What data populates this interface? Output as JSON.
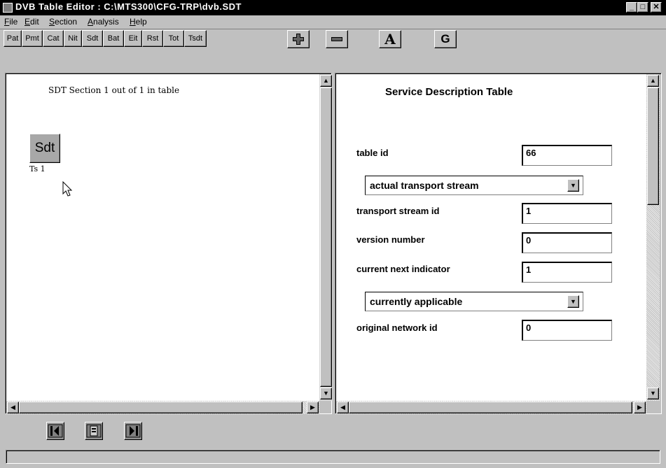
{
  "window": {
    "title": "DVB Table Editor : C:\\MTS300\\CFG-TRP\\dvb.SDT",
    "controls": {
      "minimize": "_",
      "maximize": "□",
      "close": "✕"
    }
  },
  "menu": [
    {
      "label": "File",
      "mnemonic": "F",
      "rest": "ile"
    },
    {
      "label": "Edit",
      "mnemonic": "E",
      "rest": "dit"
    },
    {
      "label": "Section",
      "mnemonic": "S",
      "rest": "ection"
    },
    {
      "label": "Analysis",
      "mnemonic": "A",
      "rest": "nalysis"
    },
    {
      "label": "Help",
      "mnemonic": "H",
      "rest": "elp"
    }
  ],
  "toolbar": {
    "tables": [
      "Pat",
      "Pmt",
      "Cat",
      "Nit",
      "Sdt",
      "Bat",
      "Eit",
      "Rst",
      "Tot",
      "Tsdt"
    ],
    "add": "+",
    "remove": "−",
    "a_button": "A",
    "g_button": "G"
  },
  "left_pane": {
    "header": "SDT Section 1 out of 1 in table",
    "node_label": "Sdt",
    "node_caption": "Ts 1"
  },
  "right_pane": {
    "heading": "Service Description Table",
    "table_id_label": "table id",
    "table_id_value": "66",
    "stream_type_selected": "actual transport stream",
    "transport_stream_id_label": "transport stream id",
    "transport_stream_id_value": "1",
    "version_number_label": "version number",
    "version_number_value": "0",
    "current_next_indicator_label": "current next indicator",
    "current_next_indicator_value": "1",
    "applicability_selected": "currently applicable",
    "original_network_id_label": "original network id",
    "original_network_id_value": "0"
  },
  "status": {
    "text": ""
  }
}
